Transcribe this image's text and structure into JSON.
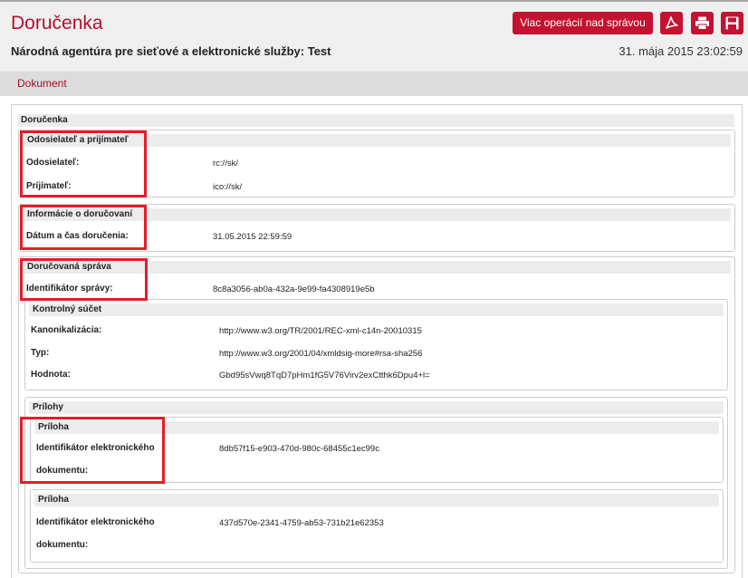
{
  "header": {
    "title": "Doručenka",
    "subtitle": "Národná agentúra pre sieťové a elektronické služby: Test",
    "datetime": "31. mája 2015 23:02:59",
    "more_ops_label": "Viac operácií nad správou",
    "icons": [
      "pdf-icon",
      "print-icon",
      "save-icon"
    ],
    "accent_color": "#c41230"
  },
  "tabs": [
    {
      "label": "Dokument"
    }
  ],
  "receipt": {
    "title": "Doručenka",
    "sender_receiver": {
      "title": "Odosielateľ a prijímateľ",
      "sender_label": "Odosielateľ:",
      "sender_value": "rc://sk/",
      "receiver_label": "Príjímateľ:",
      "receiver_value": "ico://sk/"
    },
    "delivery_info": {
      "title": "Informácie o doručovaní",
      "datetime_label": "Dátum a čas doručenia:",
      "datetime_value": "31.05.2015 22:59:59"
    },
    "message": {
      "title": "Doručovaná správa",
      "id_label": "Identifikátor správy:",
      "id_value": "8c8a3056-ab0a-432a-9e99-fa4308919e5b",
      "checksum": {
        "title": "Kontrolný súčet",
        "canon_label": "Kanonikalizácia:",
        "canon_value": "http://www.w3.org/TR/2001/REC-xml-c14n-20010315",
        "type_label": "Typ:",
        "type_value": "http://www.w3.org/2001/04/xmldsig-more#rsa-sha256",
        "value_label": "Hodnota:",
        "value_value": "Gbd95sVwq8TqD7pHm1fG5V76Virv2exCtthk6Dpu4+l="
      },
      "attachments": {
        "title": "Prílohy",
        "items": [
          {
            "title": "Príloha",
            "id_label_1": "Identifikátor elektronického",
            "id_label_2": "dokumentu:",
            "id_value": "8db57f15-e903-470d-980c-68455c1ec99c"
          },
          {
            "title": "Príloha",
            "id_label_1": "Identifikátor elektronického",
            "id_label_2": "dokumentu:",
            "id_value": "437d570e-2341-4759-ab53-731b21e62353"
          }
        ]
      }
    }
  }
}
